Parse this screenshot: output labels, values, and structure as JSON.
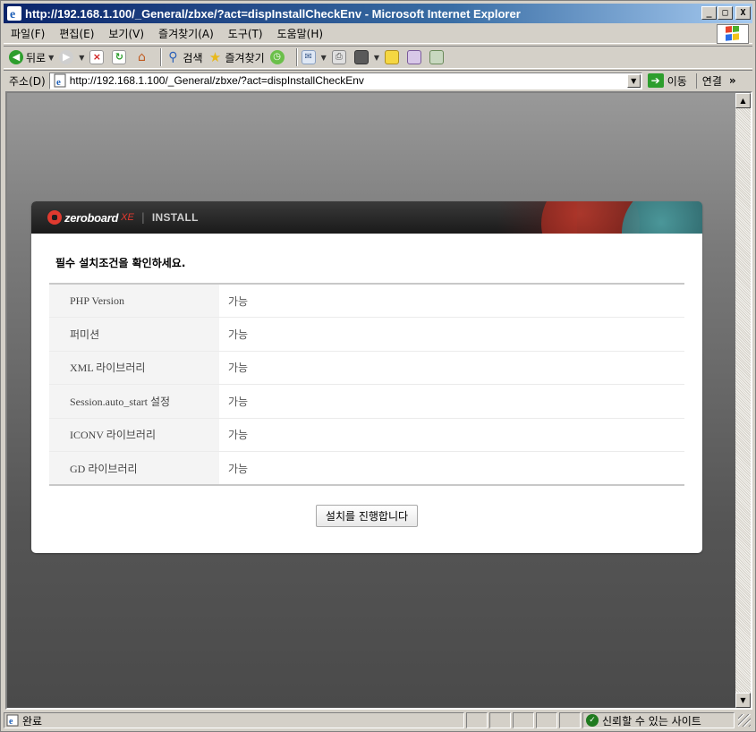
{
  "window": {
    "title": "http://192.168.1.100/_General/zbxe/?act=dispInstallCheckEnv - Microsoft Internet Explorer",
    "min_label": "_",
    "max_label": "□",
    "close_label": "X"
  },
  "menu": {
    "items": [
      "파일(F)",
      "편집(E)",
      "보기(V)",
      "즐겨찾기(A)",
      "도구(T)",
      "도움말(H)"
    ]
  },
  "toolbar": {
    "back_label": "뒤로",
    "search_label": "검색",
    "favorites_label": "즐겨찾기"
  },
  "address": {
    "label": "주소(D)",
    "url": "http://192.168.1.100/_General/zbxe/?act=dispInstallCheckEnv",
    "go_label": "이동",
    "links_label": "연결",
    "links_more": "»"
  },
  "install": {
    "brand": "zeroboard",
    "brand_suffix": "XE",
    "brand_divider": "|",
    "section": "INSTALL",
    "heading": "필수 설치조건을 확인하세요.",
    "checks": [
      {
        "name": "PHP Version",
        "status": "가능"
      },
      {
        "name": "퍼미션",
        "status": "가능"
      },
      {
        "name": "XML 라이브러리",
        "status": "가능"
      },
      {
        "name": "Session.auto_start 설정",
        "status": "가능"
      },
      {
        "name": "ICONV 라이브러리",
        "status": "가능"
      },
      {
        "name": "GD 라이브러리",
        "status": "가능"
      }
    ],
    "proceed_button": "설치를 진행합니다"
  },
  "status": {
    "text": "완료",
    "zone": "신뢰할 수 있는 사이트"
  },
  "colors": {
    "titlebar": "#0a246a",
    "chrome": "#d4d0c8",
    "brand_red": "#e03a2f"
  }
}
